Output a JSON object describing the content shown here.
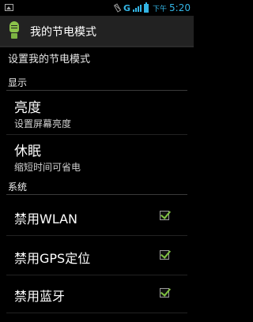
{
  "status_bar": {
    "network": "G",
    "ampm": "下午",
    "time": "5:20"
  },
  "action_bar": {
    "title": "我的节电模式",
    "icon": "power-save-bulb-icon"
  },
  "header": {
    "title": "设置我的节电模式"
  },
  "sections": {
    "display": {
      "title": "显示",
      "brightness": {
        "title": "亮度",
        "summary": "设置屏幕亮度"
      },
      "sleep": {
        "title": "休眠",
        "summary": "缩短时间可省电"
      }
    },
    "system": {
      "title": "系统",
      "items": [
        {
          "label": "禁用WLAN",
          "checked": true
        },
        {
          "label": "禁用GPS定位",
          "checked": true
        },
        {
          "label": "禁用蓝牙",
          "checked": true
        }
      ]
    }
  },
  "colors": {
    "accent": "#33b5e5",
    "checkmark": "#7fc241"
  }
}
